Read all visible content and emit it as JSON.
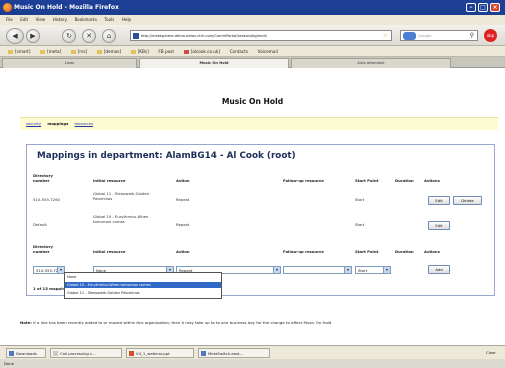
{
  "window": {
    "title": "Music On Hold - Mozilla Firefox"
  },
  "menu": [
    "File",
    "Edit",
    "View",
    "History",
    "Bookmarks",
    "Tools",
    "Help"
  ],
  "nav": {
    "url": "http://metasphere.demo.netas-ctrh.com/CommPortal/session/bg/moh/",
    "search_placeholder": "Google"
  },
  "bookmarks": [
    "[smart]",
    "[meta]",
    "[rss]",
    "[demos]",
    "[KBs]",
    "FB post",
    "[alcook.co.uk]",
    "Contacts",
    "Voicemail"
  ],
  "tabs": [
    "Lines",
    "Music On Hold",
    "Auto attendant"
  ],
  "page": {
    "title": "Music On Hold",
    "subnav": {
      "security": "security",
      "mappings": "mappings",
      "resources": "resources"
    },
    "heading": "Mappings in department: AlamBG14 - Al Cook (root)",
    "headers": {
      "directory_number": "Directory number",
      "initial_resource": "Initial resource",
      "action": "Action",
      "follow_up": "Follow-up resource",
      "start_point": "Start Point",
      "duration": "Duration",
      "actions": "Actions"
    },
    "rows": [
      {
        "number": "510-555-7260",
        "initial": "Global 11 - Sleepwalk-Golden Palominos",
        "action": "Repeat",
        "start": "Start",
        "edit": "Edit",
        "delete": "Delete"
      },
      {
        "number": "Default",
        "initial": "Global 10 - Eurythmics-When tomorrow comes",
        "action": "Repeat",
        "start": "Start",
        "edit": "Edit"
      }
    ],
    "add_row": {
      "number_value": "510-555-7260",
      "initial_value": "None",
      "action_value": "Repeat",
      "followup_value": "",
      "start_value": "Start",
      "add_label": "Add"
    },
    "dropdown_options": [
      "None",
      "Global 10 - Eurythmics-When tomorrow comes",
      "Global 11 - Sleepwalk-Golden Palominos"
    ],
    "dropdown_highlighted_index": 1,
    "count": "1 of 15 mappings",
    "note_label": "Note:",
    "note_text": "If a line has been recently added to or moved within this organization, then it may take up to to one business day for the change to affect Music On Hold"
  },
  "downloads": [
    "Downloads",
    "Call processing c...",
    "V4_1_webinar.ppt",
    "MetaSwitch-east..."
  ],
  "download_close": "Clear",
  "status": "Done"
}
